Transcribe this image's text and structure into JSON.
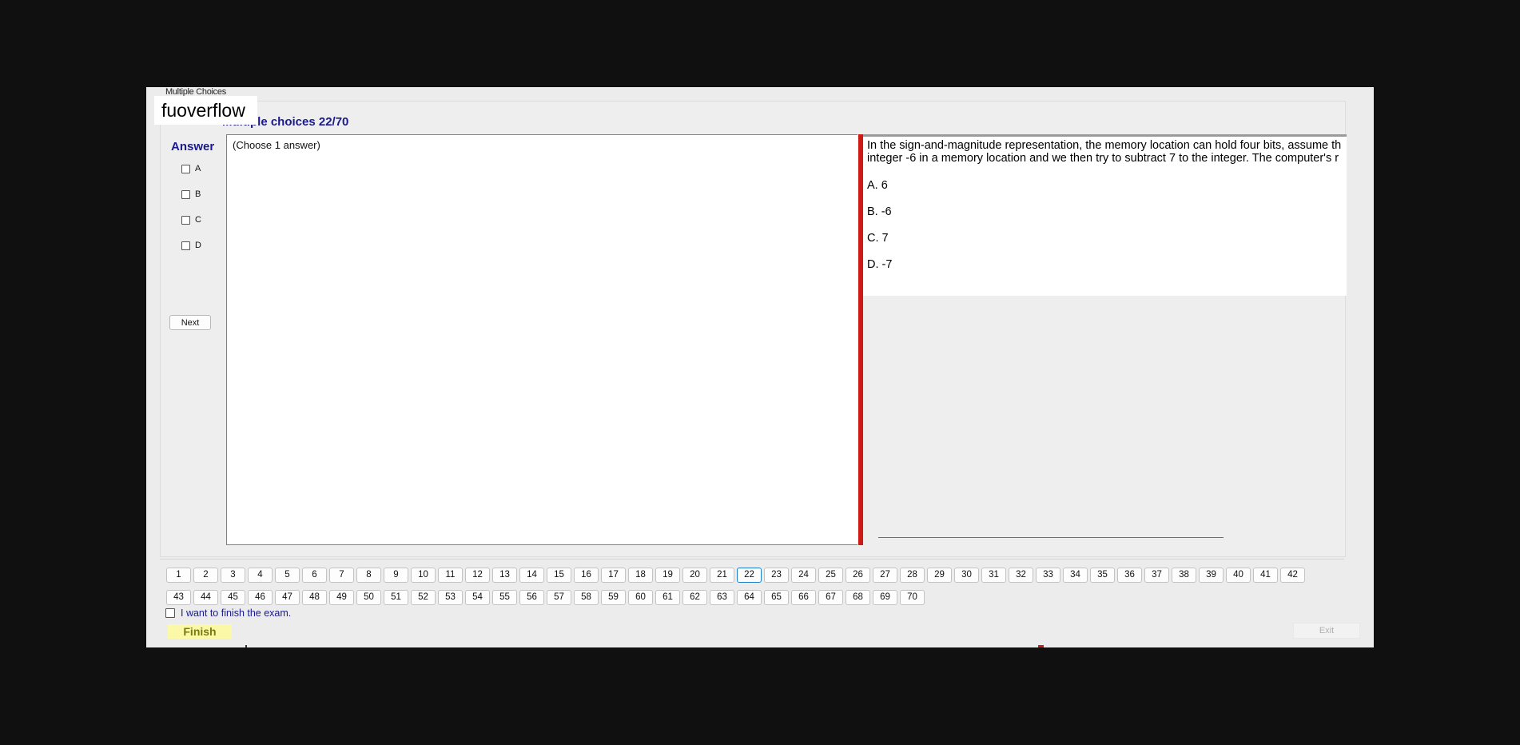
{
  "window": {
    "group_caption": "Multiple Choices"
  },
  "watermark": "fuoverflow",
  "section_title": "Multiple choices 22/70",
  "answer": {
    "heading": "Answer",
    "options": [
      "A",
      "B",
      "C",
      "D"
    ],
    "hint": "(Choose 1 answer)",
    "next_label": "Next"
  },
  "question": {
    "lines": [
      "In the sign-and-magnitude representation, the memory location can hold four bits, assume th",
      "integer -6 in a memory location and we then try to subtract 7 to the integer. The computer's r"
    ],
    "choices": [
      "A.  6",
      "B.  -6",
      "C.  7",
      "D.  -7"
    ]
  },
  "navigation": {
    "row1": [
      "1",
      "2",
      "3",
      "4",
      "5",
      "6",
      "7",
      "8",
      "9",
      "10",
      "11",
      "12",
      "13",
      "14",
      "15",
      "16",
      "17",
      "18",
      "19",
      "20",
      "21",
      "22",
      "23",
      "24",
      "25",
      "26",
      "27",
      "28",
      "29",
      "30",
      "31",
      "32",
      "33",
      "34",
      "35",
      "36",
      "37",
      "38",
      "39",
      "40",
      "41",
      "42"
    ],
    "row2": [
      "43",
      "44",
      "45",
      "46",
      "47",
      "48",
      "49",
      "50",
      "51",
      "52",
      "53",
      "54",
      "55",
      "56",
      "57",
      "58",
      "59",
      "60",
      "61",
      "62",
      "63",
      "64",
      "65",
      "66",
      "67",
      "68",
      "69",
      "70"
    ],
    "current": "22"
  },
  "footer": {
    "finish_checkbox_label": "I want to finish the exam.",
    "finish_label": "Finish",
    "exit_label": "Exit"
  },
  "colors": {
    "accent": "#1a1a8c",
    "splitter": "#cc1a14",
    "finish_bg": "#fbf8a8"
  }
}
